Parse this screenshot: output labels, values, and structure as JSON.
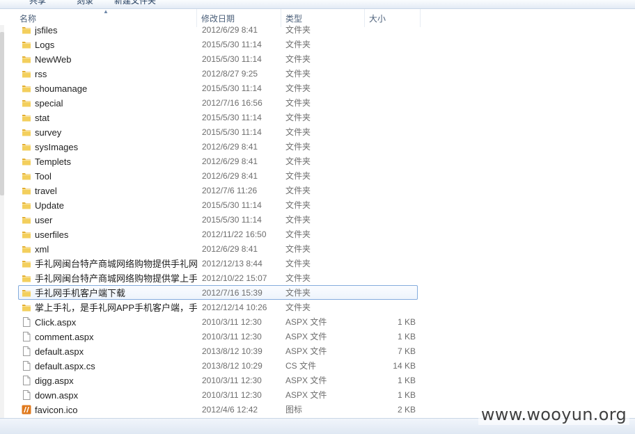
{
  "toolbar": {
    "items": [
      "共享",
      "刻录",
      "新建文件夹"
    ]
  },
  "columns": {
    "name": "名称",
    "date": "修改日期",
    "type": "类型",
    "size": "大小"
  },
  "files": [
    {
      "name": "jsfiles",
      "date": "2012/6/29 8:41",
      "type": "文件夹",
      "size": "",
      "icon": "folder-icon"
    },
    {
      "name": "Logs",
      "date": "2015/5/30 11:14",
      "type": "文件夹",
      "size": "",
      "icon": "folder-icon"
    },
    {
      "name": "NewWeb",
      "date": "2015/5/30 11:14",
      "type": "文件夹",
      "size": "",
      "icon": "folder-icon"
    },
    {
      "name": "rss",
      "date": "2012/8/27 9:25",
      "type": "文件夹",
      "size": "",
      "icon": "folder-icon"
    },
    {
      "name": "shoumanage",
      "date": "2015/5/30 11:14",
      "type": "文件夹",
      "size": "",
      "icon": "folder-icon"
    },
    {
      "name": "special",
      "date": "2012/7/16 16:56",
      "type": "文件夹",
      "size": "",
      "icon": "folder-icon"
    },
    {
      "name": "stat",
      "date": "2015/5/30 11:14",
      "type": "文件夹",
      "size": "",
      "icon": "folder-icon"
    },
    {
      "name": "survey",
      "date": "2015/5/30 11:14",
      "type": "文件夹",
      "size": "",
      "icon": "folder-icon"
    },
    {
      "name": "sysImages",
      "date": "2012/6/29 8:41",
      "type": "文件夹",
      "size": "",
      "icon": "folder-icon"
    },
    {
      "name": "Templets",
      "date": "2012/6/29 8:41",
      "type": "文件夹",
      "size": "",
      "icon": "folder-icon"
    },
    {
      "name": "Tool",
      "date": "2012/6/29 8:41",
      "type": "文件夹",
      "size": "",
      "icon": "folder-icon"
    },
    {
      "name": "travel",
      "date": "2012/7/6 11:26",
      "type": "文件夹",
      "size": "",
      "icon": "folder-icon"
    },
    {
      "name": "Update",
      "date": "2015/5/30 11:14",
      "type": "文件夹",
      "size": "",
      "icon": "folder-icon"
    },
    {
      "name": "user",
      "date": "2015/5/30 11:14",
      "type": "文件夹",
      "size": "",
      "icon": "folder-icon"
    },
    {
      "name": "userfiles",
      "date": "2012/11/22 16:50",
      "type": "文件夹",
      "size": "",
      "icon": "folder-icon"
    },
    {
      "name": "xml",
      "date": "2012/6/29 8:41",
      "type": "文件夹",
      "size": "",
      "icon": "folder-icon"
    },
    {
      "name": "手礼网闽台特产商城网络购物提供手礼网...",
      "date": "2012/12/13 8:44",
      "type": "文件夹",
      "size": "",
      "icon": "folder-icon"
    },
    {
      "name": "手礼网闽台特产商城网络购物提供掌上手...",
      "date": "2012/10/22 15:07",
      "type": "文件夹",
      "size": "",
      "icon": "folder-icon"
    },
    {
      "name": "手礼网手机客户端下载",
      "date": "2012/7/16 15:39",
      "type": "文件夹",
      "size": "",
      "icon": "folder-icon",
      "selected": true
    },
    {
      "name": "掌上手礼，是手礼网APP手机客户端，手...",
      "date": "2012/12/14 10:26",
      "type": "文件夹",
      "size": "",
      "icon": "folder-icon"
    },
    {
      "name": "Click.aspx",
      "date": "2010/3/11 12:30",
      "type": "ASPX 文件",
      "size": "1 KB",
      "icon": "file-icon"
    },
    {
      "name": "comment.aspx",
      "date": "2010/3/11 12:30",
      "type": "ASPX 文件",
      "size": "1 KB",
      "icon": "file-icon"
    },
    {
      "name": "default.aspx",
      "date": "2013/8/12 10:39",
      "type": "ASPX 文件",
      "size": "7 KB",
      "icon": "file-icon"
    },
    {
      "name": "default.aspx.cs",
      "date": "2013/8/12 10:29",
      "type": "CS 文件",
      "size": "14 KB",
      "icon": "file-icon"
    },
    {
      "name": "digg.aspx",
      "date": "2010/3/11 12:30",
      "type": "ASPX 文件",
      "size": "1 KB",
      "icon": "file-icon"
    },
    {
      "name": "down.aspx",
      "date": "2010/3/11 12:30",
      "type": "ASPX 文件",
      "size": "1 KB",
      "icon": "file-icon"
    },
    {
      "name": "favicon.ico",
      "date": "2012/4/6 12:42",
      "type": "图标",
      "size": "2 KB",
      "icon": "favicon-icon"
    }
  ],
  "watermark": "www.wooyun.org",
  "colors": {
    "folder": "#e8b93c",
    "selection_border": "#84acdd",
    "favicon": "#e07a1e"
  }
}
